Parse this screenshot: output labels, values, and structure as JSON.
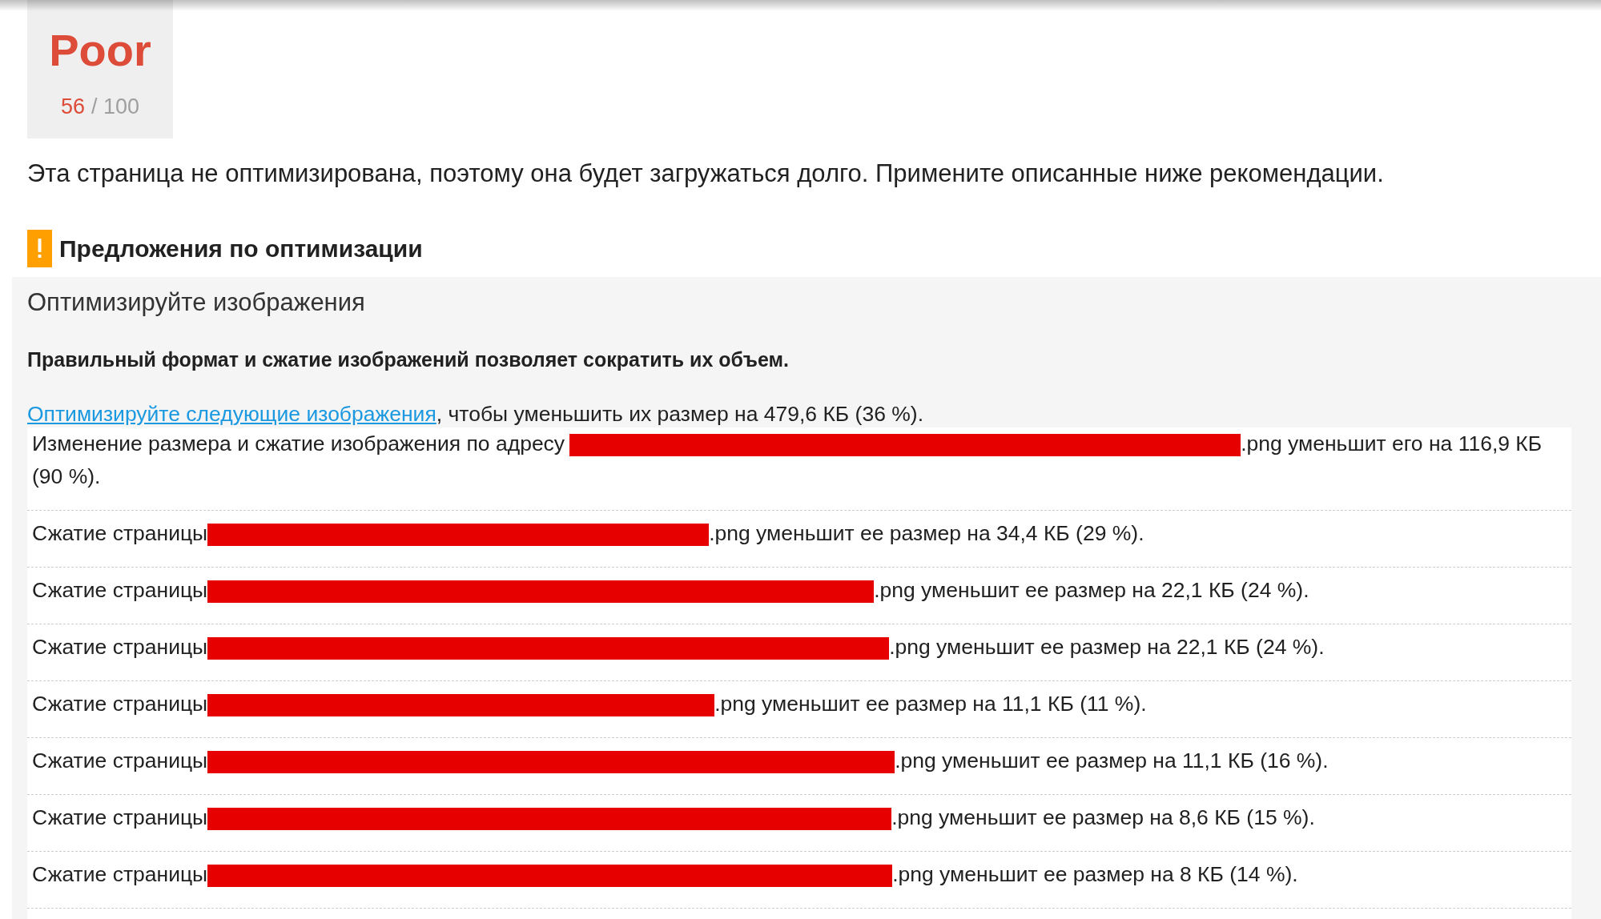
{
  "score": {
    "rating": "Poor",
    "value": "56",
    "out_of": "/ 100"
  },
  "summary": "Эта страница не оптимизирована, поэтому она будет загружаться долго. Примените описанные ниже рекомендации.",
  "suggestions": {
    "title": "Предложения по оптимизации",
    "rules": [
      {
        "title": "Оптимизируйте изображения",
        "summary": "Правильный формат и сжатие изображений позволяет сократить их объем.",
        "link": "Оптимизируйте следующие изображения",
        "detail": ", чтобы уменьшить их размер на 479,6 КБ (36 %).",
        "items": [
          {
            "before": "Изменение размера и сжатие изображения по адресу",
            "after": ".png уменьшит его на 116,9 КБ (90 %)."
          },
          {
            "before": "Сжатие страницы",
            "after": ".png уменьшит ее размер на 34,4 КБ (29 %)."
          },
          {
            "before": "Сжатие страницы",
            "after": ".png уменьшит ее размер на 22,1 КБ (24 %)."
          },
          {
            "before": "Сжатие страницы",
            "after": ".png уменьшит ее размер на 22,1 КБ (24 %)."
          },
          {
            "before": "Сжатие страницы",
            "after": ".png уменьшит ее размер на 11,1 КБ (11 %)."
          },
          {
            "before": "Сжатие страницы",
            "after": ".png уменьшит ее размер на 11,1 КБ (16 %)."
          },
          {
            "before": "Сжатие страницы",
            "after": ".png уменьшит ее размер на 8,6 КБ (15 %)."
          },
          {
            "before": "Сжатие страницы",
            "after": ".png уменьшит ее размер на 8 КБ (14 %)."
          }
        ]
      }
    ]
  }
}
